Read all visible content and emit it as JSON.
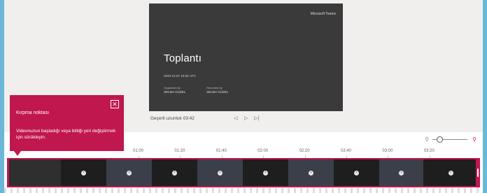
{
  "preview": {
    "brand": "Microsoft Teams",
    "title": "Toplantı",
    "date": "2020-12-07 10:55 UTC",
    "organizer_label": "Organized by",
    "organizer": "SELMA GÜZEL",
    "recorded_label": "Recorded by",
    "recorder": "SELMA GÜZEL"
  },
  "playback": {
    "duration": "Geçerli uzunluk 03:42",
    "prev_icon": "previous-frame-icon",
    "play_icon": "play-icon",
    "next_icon": "next-frame-icon"
  },
  "timeline": {
    "ticks": [
      "01:00",
      "01:20",
      "01:40",
      "02:00",
      "02:20",
      "02:40",
      "03:00",
      "03:20"
    ],
    "zoom_out_icon": "zoom-out-icon",
    "zoom_in_icon": "zoom-in-icon",
    "zoom_level": 0.2
  },
  "coachmark": {
    "title": "Kırpma noktası",
    "body": "Videonuzun başladığı veya bittiği yeri değiştirmek için sürükleyin.",
    "close_icon": "close-icon"
  },
  "colors": {
    "accent": "#c0174e",
    "slide": "#3a3a3a"
  }
}
